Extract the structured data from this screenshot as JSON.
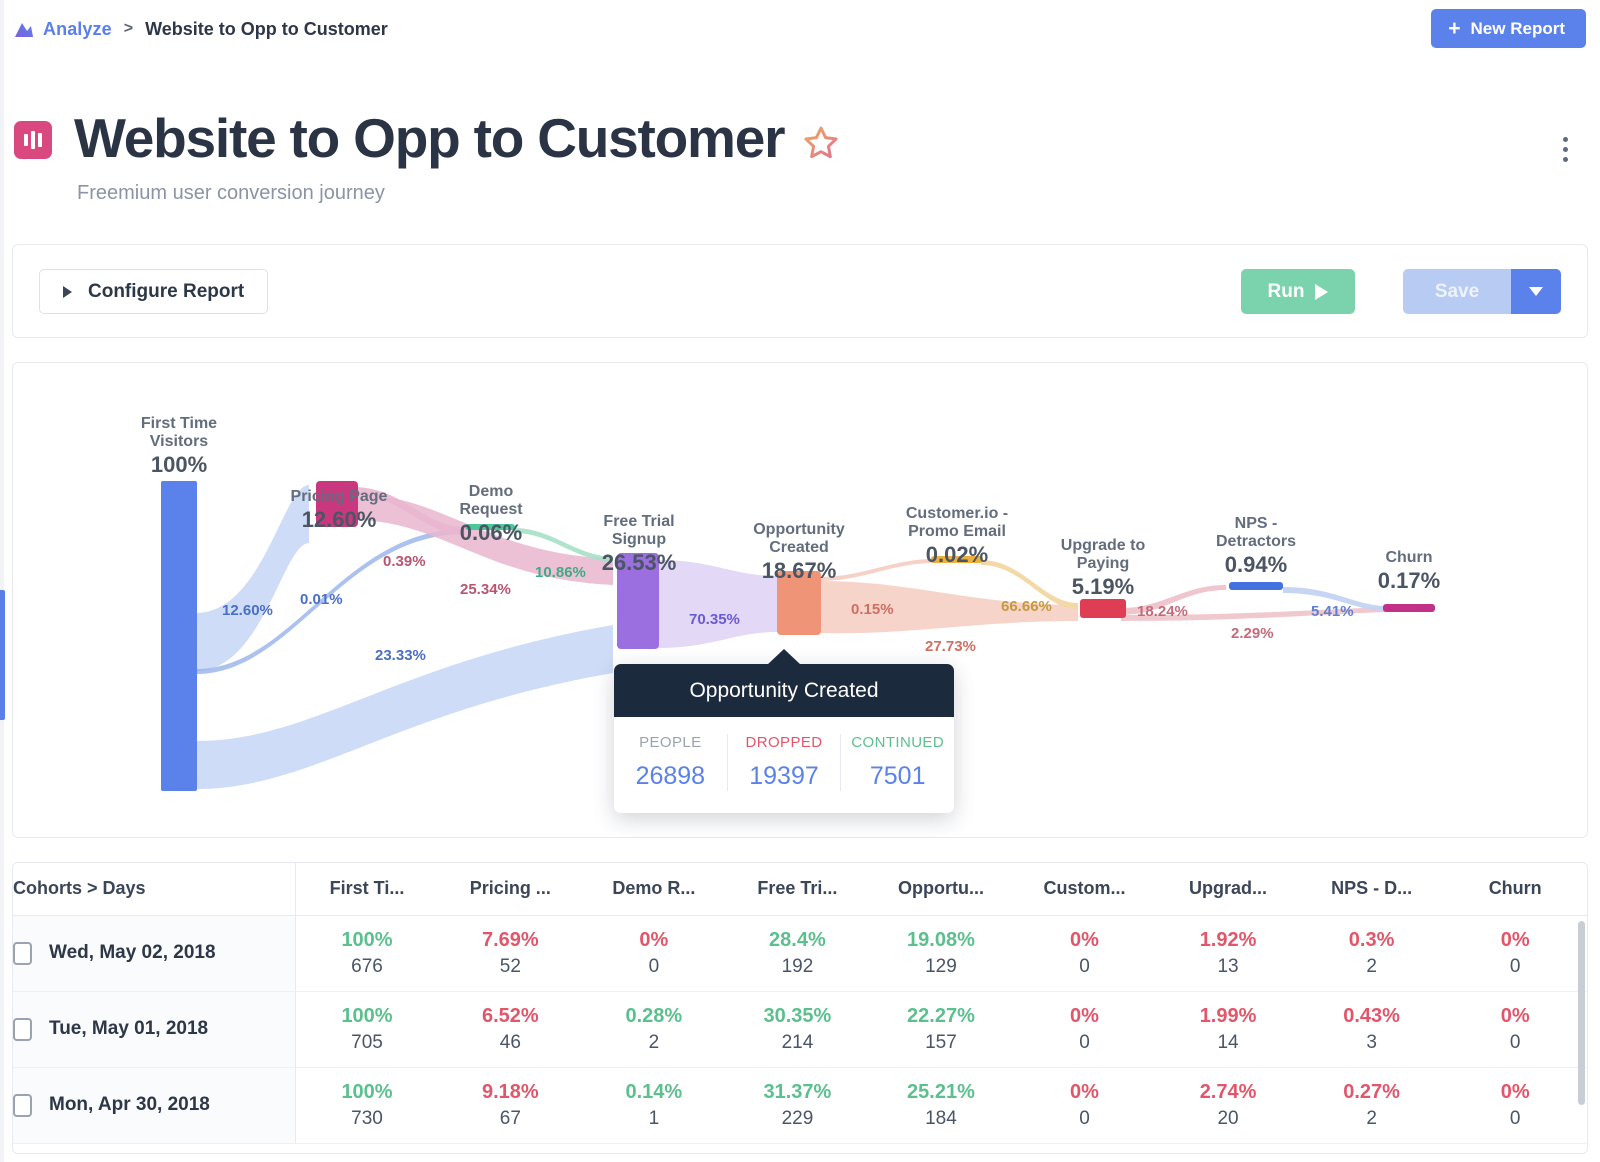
{
  "breadcrumb": {
    "icon": "analyze-chart-icon",
    "root": "Analyze",
    "separator": ">",
    "current": "Website to Opp to Customer"
  },
  "header": {
    "new_report_label": "New Report",
    "plus": "+",
    "report_icon": "bar-chart-icon",
    "title": "Website to Opp to Customer",
    "star_icon": "star-outline-icon",
    "subtitle": "Freemium user conversion journey",
    "kebab_icon": "more-vertical-icon"
  },
  "toolbar": {
    "configure_label": "Configure Report",
    "run_label": "Run",
    "save_label": "Save",
    "caret_icon": "chevron-down-icon",
    "play_icon": "play-icon",
    "expand_icon": "triangle-right-icon"
  },
  "tooltip": {
    "title": "Opportunity Created",
    "cols": [
      {
        "key": "PEOPLE",
        "value": "26898",
        "color": "#9aa3b2"
      },
      {
        "key": "DROPPED",
        "value": "19397",
        "color": "#e2566a"
      },
      {
        "key": "CONTINUED",
        "value": "7501",
        "color": "#5bc08e"
      }
    ]
  },
  "chart_data": {
    "type": "sankey",
    "title": "Website to Opp to Customer",
    "nodes": [
      {
        "name": "First Time Visitors",
        "pct": "100%",
        "value": 100.0,
        "color": "#5b82ea"
      },
      {
        "name": "Pricing Page",
        "pct": "12.60%",
        "value": 12.6,
        "color": "#c9387f"
      },
      {
        "name": "Demo Request",
        "pct": "0.06%",
        "value": 0.06,
        "color": "#4cc79a"
      },
      {
        "name": "Free Trial Signup",
        "pct": "26.53%",
        "value": 26.53,
        "color": "#9b6fe0"
      },
      {
        "name": "Opportunity Created",
        "pct": "18.67%",
        "value": 18.67,
        "color": "#ef9476"
      },
      {
        "name": "Customer.io - Promo Email",
        "pct": "0.02%",
        "value": 0.02,
        "color": "#eeb03c"
      },
      {
        "name": "Upgrade to Paying",
        "pct": "5.19%",
        "value": 5.19,
        "color": "#df3d53"
      },
      {
        "name": "NPS - Detractors",
        "pct": "0.94%",
        "value": 0.94,
        "color": "#4470e0"
      },
      {
        "name": "Churn",
        "pct": "0.17%",
        "value": 0.17,
        "color": "#c2308a"
      }
    ],
    "links": [
      {
        "from": "First Time Visitors",
        "to": "Pricing Page",
        "pct": "12.60%",
        "value": 12.6,
        "color": "#c6d6f6"
      },
      {
        "from": "First Time Visitors",
        "to": "Demo Request",
        "pct": "0.01%",
        "value": 0.01,
        "color": "#8fadea"
      },
      {
        "from": "First Time Visitors",
        "to": "Free Trial Signup",
        "pct": "23.33%",
        "value": 23.33,
        "color": "#c6d6f6"
      },
      {
        "from": "Pricing Page",
        "to": "Demo Request",
        "pct": "0.39%",
        "value": 0.39,
        "color": "#e9b6cf"
      },
      {
        "from": "Pricing Page",
        "to": "Free Trial Signup",
        "pct": "25.34%",
        "value": 25.34,
        "color": "#e9b6cf"
      },
      {
        "from": "Demo Request",
        "to": "Free Trial Signup",
        "pct": "10.86%",
        "value": 10.86,
        "color": "#a6e0c6"
      },
      {
        "from": "Free Trial Signup",
        "to": "Opportunity Created",
        "pct": "70.35%",
        "value": 70.35,
        "color": "#ded1f5"
      },
      {
        "from": "Opportunity Created",
        "to": "Customer.io - Promo Email",
        "pct": "0.15%",
        "value": 0.15,
        "color": "#f5cfc4"
      },
      {
        "from": "Opportunity Created",
        "to": "Upgrade to Paying",
        "pct": "27.73%",
        "value": 27.73,
        "color": "#f5cfc4"
      },
      {
        "from": "Customer.io - Promo Email",
        "to": "Upgrade to Paying",
        "pct": "66.66%",
        "value": 66.66,
        "color": "#f2d7a2"
      },
      {
        "from": "Upgrade to Paying",
        "to": "NPS - Detractors",
        "pct": "18.24%",
        "value": 18.24,
        "color": "#eec3ca"
      },
      {
        "from": "Upgrade to Paying",
        "to": "Churn",
        "pct": "2.29%",
        "value": 2.29,
        "color": "#eec3ca"
      },
      {
        "from": "NPS - Detractors",
        "to": "Churn",
        "pct": "5.41%",
        "value": 5.41,
        "color": "#c3d3f3"
      }
    ]
  },
  "table": {
    "cohort_header": "Cohorts > Days",
    "columns": [
      "First Ti...",
      "Pricing ...",
      "Demo R...",
      "Free Tri...",
      "Opportu...",
      "Custom...",
      "Upgrad...",
      "NPS - D...",
      "Churn"
    ],
    "rows": [
      {
        "date": "Wed, May 02, 2018",
        "cells": [
          {
            "pct": "100%",
            "dir": "up",
            "count": "676"
          },
          {
            "pct": "7.69%",
            "dir": "down",
            "count": "52"
          },
          {
            "pct": "0%",
            "dir": "down",
            "count": "0"
          },
          {
            "pct": "28.4%",
            "dir": "up",
            "count": "192"
          },
          {
            "pct": "19.08%",
            "dir": "up",
            "count": "129"
          },
          {
            "pct": "0%",
            "dir": "down",
            "count": "0"
          },
          {
            "pct": "1.92%",
            "dir": "down",
            "count": "13"
          },
          {
            "pct": "0.3%",
            "dir": "down",
            "count": "2"
          },
          {
            "pct": "0%",
            "dir": "down",
            "count": "0"
          }
        ]
      },
      {
        "date": "Tue, May 01, 2018",
        "cells": [
          {
            "pct": "100%",
            "dir": "up",
            "count": "705"
          },
          {
            "pct": "6.52%",
            "dir": "down",
            "count": "46"
          },
          {
            "pct": "0.28%",
            "dir": "up",
            "count": "2"
          },
          {
            "pct": "30.35%",
            "dir": "up",
            "count": "214"
          },
          {
            "pct": "22.27%",
            "dir": "up",
            "count": "157"
          },
          {
            "pct": "0%",
            "dir": "down",
            "count": "0"
          },
          {
            "pct": "1.99%",
            "dir": "down",
            "count": "14"
          },
          {
            "pct": "0.43%",
            "dir": "down",
            "count": "3"
          },
          {
            "pct": "0%",
            "dir": "down",
            "count": "0"
          }
        ]
      },
      {
        "date": "Mon, Apr 30, 2018",
        "cells": [
          {
            "pct": "100%",
            "dir": "up",
            "count": "730"
          },
          {
            "pct": "9.18%",
            "dir": "down",
            "count": "67"
          },
          {
            "pct": "0.14%",
            "dir": "up",
            "count": "1"
          },
          {
            "pct": "31.37%",
            "dir": "up",
            "count": "229"
          },
          {
            "pct": "25.21%",
            "dir": "up",
            "count": "184"
          },
          {
            "pct": "0%",
            "dir": "down",
            "count": "0"
          },
          {
            "pct": "2.74%",
            "dir": "down",
            "count": "20"
          },
          {
            "pct": "0.27%",
            "dir": "down",
            "count": "2"
          },
          {
            "pct": "0%",
            "dir": "down",
            "count": "0"
          }
        ]
      }
    ]
  },
  "colors": {
    "accent_blue": "#5b82ea",
    "green": "#7bd3ae",
    "pink": "#d9497f",
    "up": "#5bc08e",
    "down": "#e2566a",
    "tooltip_bg": "#1c2a3d"
  }
}
